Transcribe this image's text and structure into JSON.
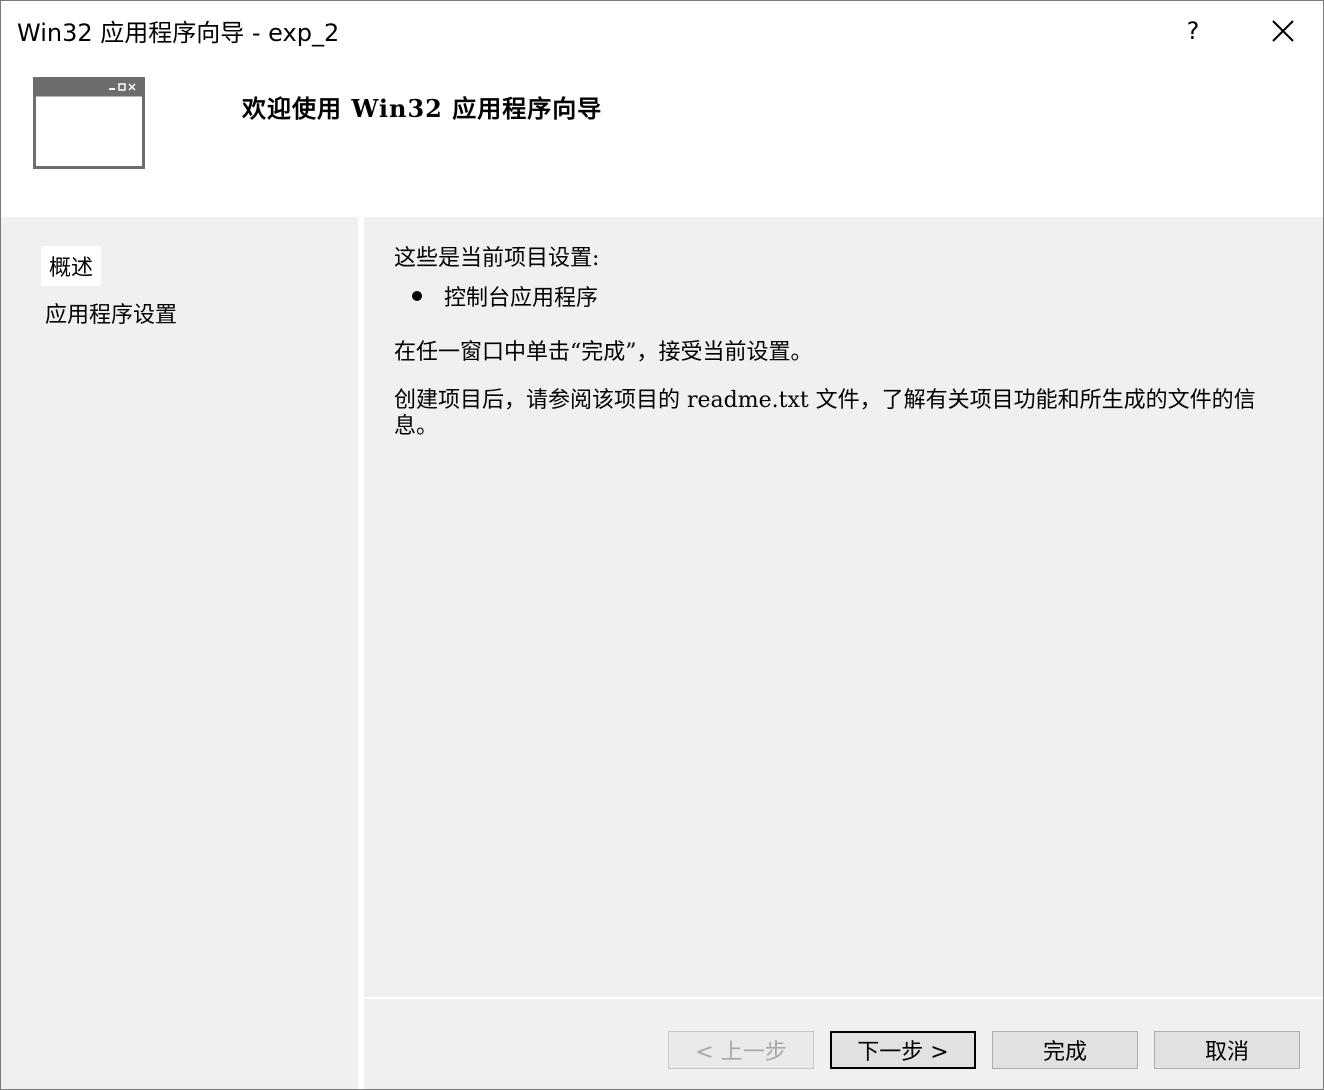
{
  "window": {
    "title": "Win32 应用程序向导 - exp_2",
    "help_label": "?"
  },
  "header": {
    "title": "欢迎使用 Win32 应用程序向导"
  },
  "sidebar": {
    "items": [
      {
        "label": "概述"
      },
      {
        "label": "应用程序设置"
      }
    ]
  },
  "content": {
    "settings_intro": "这些是当前项目设置:",
    "settings_item": "控制台应用程序",
    "finish_hint": "在任一窗口中单击“完成”，接受当前设置。",
    "readme_hint": "创建项目后，请参阅该项目的 readme.txt 文件，了解有关项目功能和所生成的文件的信息。"
  },
  "buttons": {
    "prev": "< 上一步",
    "next": "下一步 >",
    "finish": "完成",
    "cancel": "取消"
  }
}
